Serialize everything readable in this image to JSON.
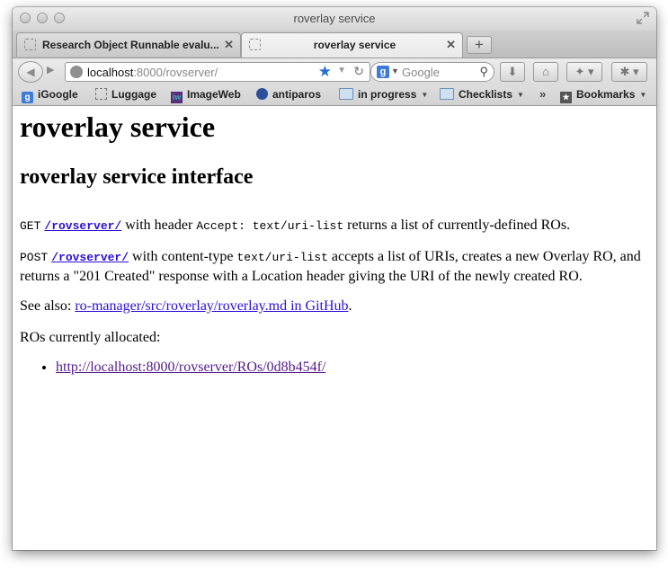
{
  "window": {
    "title": "roverlay service"
  },
  "tabs": [
    {
      "label": "Research Object Runnable evalu...",
      "close": "✕"
    },
    {
      "label": "roverlay service",
      "close": "✕"
    }
  ],
  "newtab_label": "+",
  "navbar": {
    "url_host": "localhost",
    "url_rest": ":8000/rovserver/",
    "search_placeholder": "Google"
  },
  "bookmarks": [
    {
      "label": "iGoogle",
      "icon": "igoogle-icon"
    },
    {
      "label": "Luggage",
      "icon": "page-icon"
    },
    {
      "label": "ImageWeb",
      "icon": "imageweb-icon"
    },
    {
      "label": "antiparos",
      "icon": "antiparos-icon"
    },
    {
      "label": "in progress",
      "icon": "folder-icon"
    },
    {
      "label": "Checklists",
      "icon": "folder-icon"
    },
    {
      "label": "Bookmarks",
      "icon": "bookmarks-icon"
    }
  ],
  "content": {
    "h1": "roverlay service",
    "h2": "roverlay service interface",
    "p1": {
      "method": "GET",
      "link": "/rovserver/",
      "mid": "with header",
      "header_code": "Accept: text/uri-list",
      "tail": "returns a list of currently-defined ROs."
    },
    "p2": {
      "method": "POST",
      "link": "/rovserver/",
      "mid": "with content-type",
      "type_code": "text/uri-list",
      "tail": "accepts a list of URIs, creates a new Overlay RO, and returns a \"201 Created\" response with a Location header giving the URI of the newly created RO."
    },
    "p3": {
      "prefix": "See also:",
      "link": "ro-manager/src/roverlay/roverlay.md in GitHub",
      "suffix": "."
    },
    "p4": "ROs currently allocated:",
    "ro_list": [
      "http://localhost:8000/rovserver/ROs/0d8b454f/"
    ]
  },
  "colors": {
    "link": "#2a0fd8",
    "visited_link": "#551a8b",
    "accent_star": "#2a6fd4"
  }
}
